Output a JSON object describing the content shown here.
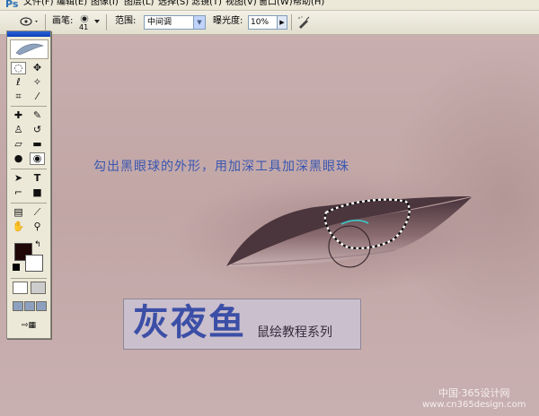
{
  "menubar": {
    "items": [
      "文件(F)",
      "编辑(E)",
      "图像(I)",
      "图层(L)",
      "选择(S)",
      "滤镜(T)",
      "视图(V)",
      "窗口(W)",
      "帮助(H)"
    ]
  },
  "options": {
    "brush_label": "画笔:",
    "brush_size": "41",
    "range_label": "范围:",
    "range_value": "中间调",
    "exposure_label": "曝光度:",
    "exposure_value": "10%",
    "icons": [
      "burn-tool-preset-icon",
      "brush-dot-icon",
      "dropdown-arrow-icon",
      "airbrush-icon"
    ]
  },
  "canvas": {
    "instruction": "勾出黑眼球的外形，用加深工具加深黑眼珠",
    "watermark_title": "灰夜鱼",
    "watermark_subtitle": "鼠绘教程系列",
    "site_cn": "中国·365设计网",
    "site_url": "www.cn365design.com",
    "colors": {
      "skin": "#c4a9a9",
      "eyelid": "#5a3f45",
      "instruction": "#3a57b0",
      "selection_highlight": "#3cc8c8"
    }
  },
  "toolbox": {
    "tools": [
      "marquee-icon",
      "move-icon",
      "lasso-icon",
      "magic-wand-icon",
      "crop-icon",
      "slice-icon",
      "healing-brush-icon",
      "brush-icon",
      "clone-stamp-icon",
      "history-brush-icon",
      "eraser-icon",
      "gradient-icon",
      "blur-icon",
      "burn-icon",
      "path-select-icon",
      "type-icon",
      "pen-icon",
      "shape-icon",
      "notes-icon",
      "eyedropper-icon",
      "hand-icon",
      "zoom-icon"
    ],
    "foreground_color": "#200808",
    "background_color": "#ffffff"
  }
}
